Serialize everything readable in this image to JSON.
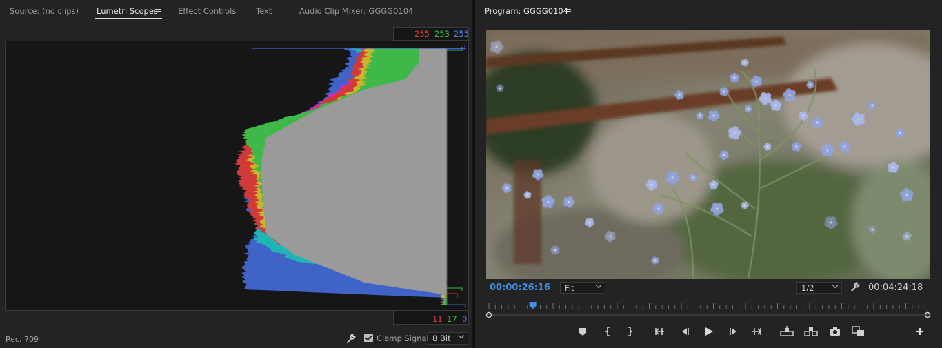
{
  "source_panel": {
    "tabs": [
      {
        "label": "Source: (no clips)"
      },
      {
        "label": "Lumetri Scopes"
      },
      {
        "label": "Effect Controls"
      },
      {
        "label": "Text"
      },
      {
        "label": "Audio Clip Mixer: GGGG0104"
      }
    ],
    "readout_top": {
      "r": "255",
      "g": "253",
      "b": "255"
    },
    "readout_bottom": {
      "r": "11",
      "g": "17",
      "b": "0"
    },
    "colorspace": "Rec. 709",
    "clamp_signal_label": "Clamp Signal",
    "clamp_signal_checked": true,
    "bit_depth": "8 Bit",
    "parade_colors": {
      "red": "#d23a3a",
      "green": "#3fb84a",
      "blue": "#3f63c7",
      "yellow": "#c9b52a",
      "cyan": "#1eb5b5",
      "magenta": "#d42bb4",
      "white": "#9a9a9a"
    }
  },
  "program_panel": {
    "title": "Program: GGGG0104",
    "current_timecode": "00:00:26:16",
    "zoom": "Fit",
    "resolution": "1/2",
    "duration": "00:04:24:18",
    "playhead_position": 0.1,
    "accent_color": "#3f8fe6",
    "controls": [
      "add-marker-icon",
      "mark-in-icon",
      "mark-out-icon",
      "go-to-in-icon",
      "step-back-icon",
      "play-icon",
      "step-forward-icon",
      "go-to-out-icon",
      "lift-icon",
      "extract-icon",
      "export-frame-icon",
      "compare-view-icon",
      "add-button-icon"
    ]
  }
}
